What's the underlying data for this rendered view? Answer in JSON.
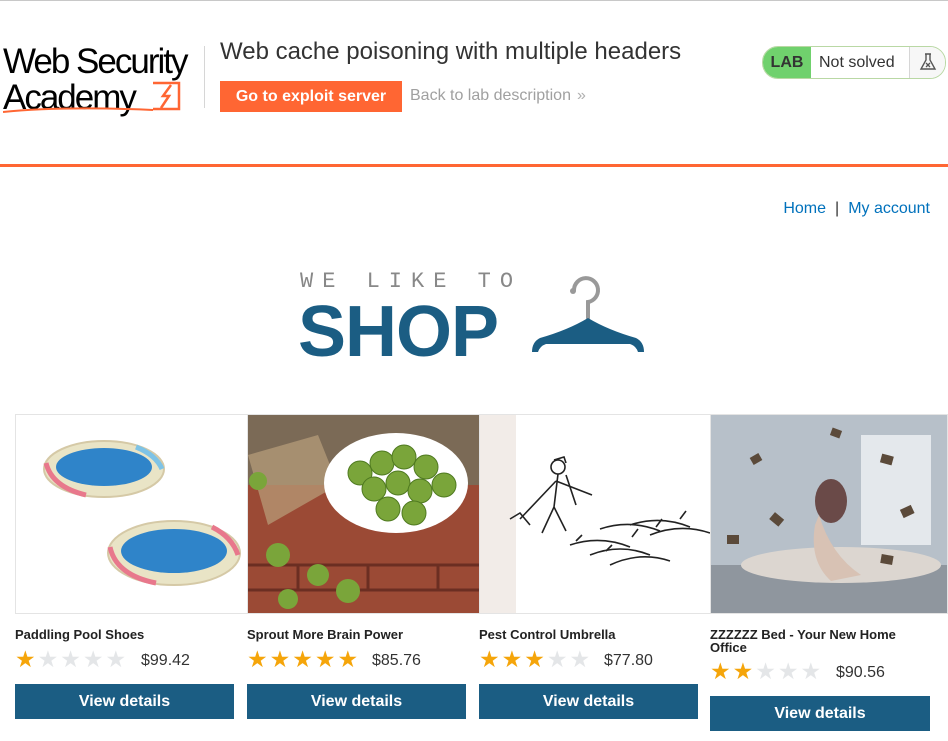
{
  "academy": {
    "logo_line1": "Web Security",
    "logo_line2": "Academy",
    "lab_title": "Web cache poisoning with multiple headers",
    "exploit_button": "Go to exploit server",
    "back_link": "Back to lab description",
    "back_icon": "»",
    "status_tag": "LAB",
    "status_text": "Not solved",
    "status_icon": "flask-icon"
  },
  "colors": {
    "accent": "#ff6633",
    "brand": "#1b5d83",
    "link": "#0071bc",
    "status_green": "#70d16d",
    "star": "#f5a50a"
  },
  "nav": {
    "home": "Home",
    "separator": "|",
    "account": "My account"
  },
  "banner": {
    "tagline": "WE LIKE TO",
    "headline": "SHOP",
    "icon": "hanger-icon"
  },
  "products": [
    {
      "name": "Paddling Pool Shoes",
      "stars": 1,
      "price": "$99.42",
      "button": "View details"
    },
    {
      "name": "Sprout More Brain Power",
      "stars": 5,
      "price": "$85.76",
      "button": "View details"
    },
    {
      "name": "Pest Control Umbrella",
      "stars": 3,
      "price": "$77.80",
      "button": "View details"
    },
    {
      "name": "ZZZZZZ Bed - Your New Home Office",
      "stars": 2,
      "price": "$90.56",
      "button": "View details"
    }
  ]
}
